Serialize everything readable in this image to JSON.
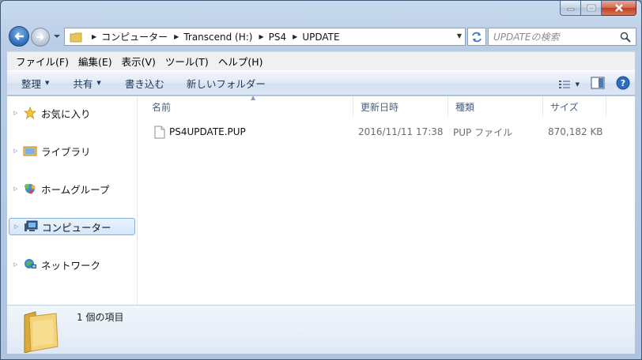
{
  "address": {
    "breadcrumbs": [
      "コンピューター",
      "Transcend (H:)",
      "PS4",
      "UPDATE"
    ]
  },
  "search": {
    "placeholder": "UPDATEの検索"
  },
  "menu": [
    "ファイル(F)",
    "編集(E)",
    "表示(V)",
    "ツール(T)",
    "ヘルプ(H)"
  ],
  "toolbar": {
    "organize": "整理",
    "share": "共有",
    "burn": "書き込む",
    "new_folder": "新しいフォルダー"
  },
  "nav": [
    {
      "label": "お気に入り",
      "icon": "star-icon"
    },
    {
      "label": "ライブラリ",
      "icon": "library-icon"
    },
    {
      "label": "ホームグループ",
      "icon": "homegroup-icon"
    },
    {
      "label": "コンピューター",
      "icon": "computer-icon",
      "selected": true
    },
    {
      "label": "ネットワーク",
      "icon": "network-icon"
    }
  ],
  "columns": {
    "name": "名前",
    "date": "更新日時",
    "type": "種類",
    "size": "サイズ"
  },
  "files": [
    {
      "name": "PS4UPDATE.PUP",
      "date": "2016/11/11 17:38",
      "type": "PUP ファイル",
      "size": "870,182 KB"
    }
  ],
  "status": {
    "item_count": "1 個の項目"
  },
  "colors": {
    "accent": "#2d6bb8",
    "selection": "#d3e6fc"
  }
}
